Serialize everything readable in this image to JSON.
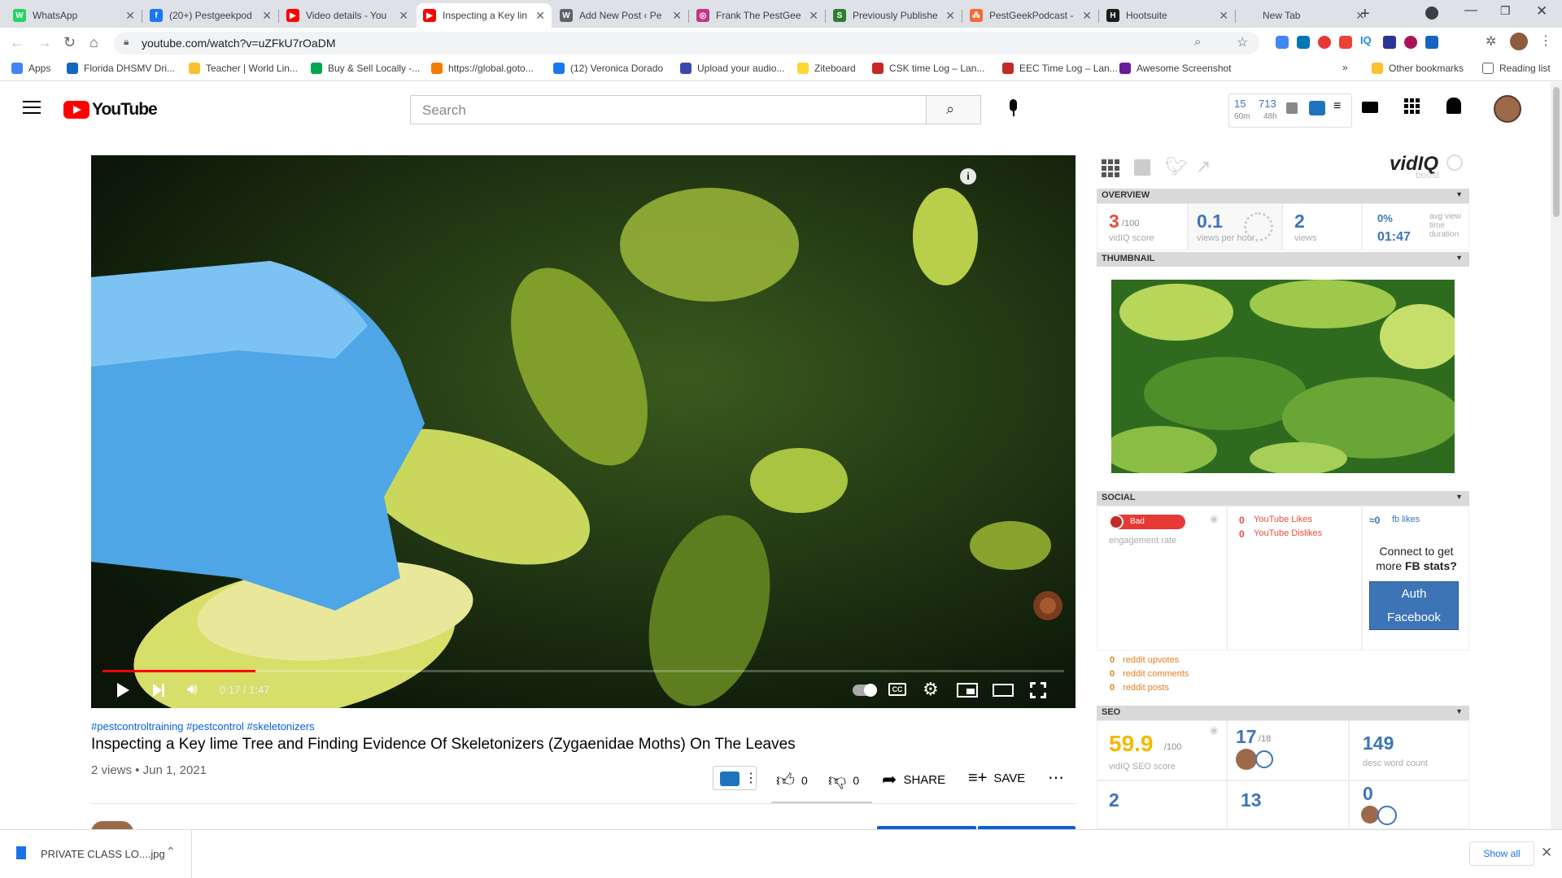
{
  "browser": {
    "tabs": [
      {
        "title": "WhatsApp",
        "color": "#25d366",
        "glyph": "W"
      },
      {
        "title": "(20+) Pestgeekpod",
        "color": "#1877f2",
        "glyph": "f"
      },
      {
        "title": "Video details - You",
        "color": "#ff0000",
        "glyph": "▶"
      },
      {
        "title": "Inspecting a Key lin",
        "color": "#ff0000",
        "glyph": "▶"
      },
      {
        "title": "Add New Post ‹ Pe",
        "color": "#5f6368",
        "glyph": "W"
      },
      {
        "title": "Frank The PestGee",
        "color": "#c13584",
        "glyph": "◎"
      },
      {
        "title": "Previously Publishe",
        "color": "#2e7d32",
        "glyph": "S"
      },
      {
        "title": "PestGeekPodcast -",
        "color": "#f06a35",
        "glyph": "⁂"
      },
      {
        "title": "Hootsuite",
        "color": "#1c1c1c",
        "glyph": "H"
      },
      {
        "title": "New Tab",
        "color": "",
        "glyph": ""
      }
    ],
    "active_tab_index": 3,
    "url": "youtube.com/watch?v=uZFkU7rOaDM",
    "bookmarks": [
      {
        "label": "Apps",
        "color": "#4285f4"
      },
      {
        "label": "Florida DHSMV Dri...",
        "color": "#1565c0"
      },
      {
        "label": "Teacher | World Lin...",
        "color": "#fbc02d"
      },
      {
        "label": "Buy & Sell Locally -...",
        "color": "#00a651"
      },
      {
        "label": "https://global.goto...",
        "color": "#f57c00"
      },
      {
        "label": "(12) Veronica Dorado",
        "color": "#1877f2"
      },
      {
        "label": "Upload your audio...",
        "color": "#3949ab"
      },
      {
        "label": "Ziteboard",
        "color": "#fdd835"
      },
      {
        "label": "CSK time Log – Lan...",
        "color": "#c62828"
      },
      {
        "label": "EEC Time Log – Lan...",
        "color": "#c62828"
      },
      {
        "label": "Awesome Screenshot",
        "color": "#6a1b9a"
      }
    ],
    "other_bookmarks": "Other bookmarks",
    "reading_list": "Reading list"
  },
  "youtube": {
    "logo_text": "YouTube",
    "search_placeholder": "Search",
    "ext_counts": {
      "a": "15",
      "a_lbl": "60m",
      "b": "713",
      "b_lbl": "48h"
    }
  },
  "player": {
    "time": "0:17 / 1:47",
    "progress": 0.159
  },
  "video": {
    "hashtags": "#pestcontroltraining #pestcontrol #skeletonizers",
    "title": "Inspecting a Key lime Tree and Finding Evidence Of Skeletonizers (Zygaenidae Moths) On The Leaves",
    "meta": "2 views • Jun 1, 2021",
    "likes": "0",
    "dislikes": "0",
    "share": "SHARE",
    "save": "SAVE"
  },
  "vidiq": {
    "brand": "vidIQ",
    "brand_sub": "boost",
    "overview_label": "OVERVIEW",
    "score": "3",
    "score_den": "/100",
    "score_lbl": "vidIQ score",
    "vph": "0.1",
    "vph_lbl": "views per hour",
    "views": "2",
    "views_lbl": "views",
    "avg_pct": "0%",
    "avg_time": "01:47",
    "avg_lbl": "avg view time duration",
    "thumbnail_label": "THUMBNAIL",
    "social_label": "SOCIAL",
    "engagement_badge": "Bad",
    "engagement_lbl": "engagement rate",
    "yt_likes": "0",
    "yt_likes_lbl": "YouTube Likes",
    "yt_dislikes": "0",
    "yt_dislikes_lbl": "YouTube Dislikes",
    "fb_likes": "0",
    "fb_likes_lbl": "fb likes",
    "connect_text_1": "Connect to get",
    "connect_text_2": "more",
    "connect_fb": "FB",
    "connect_text_3": "stats?",
    "auth_btn_1": "Auth",
    "auth_btn_2": "Facebook",
    "reddit": [
      {
        "value": "0",
        "label": "reddit upvotes"
      },
      {
        "value": "0",
        "label": "reddit comments"
      },
      {
        "value": "0",
        "label": "reddit posts"
      }
    ],
    "seo_label": "SEO",
    "seo_score": "59.9",
    "seo_den": "/100",
    "seo_lbl": "vidIQ SEO score",
    "tags_count": "17",
    "tags_den": "/18",
    "desc_words": "149",
    "desc_words_lbl": "desc word count",
    "row2_a": "2",
    "row2_b": "13",
    "row2_c": "0"
  },
  "downloads": {
    "file": "PRIVATE CLASS LO....jpg",
    "show_all": "Show all"
  }
}
